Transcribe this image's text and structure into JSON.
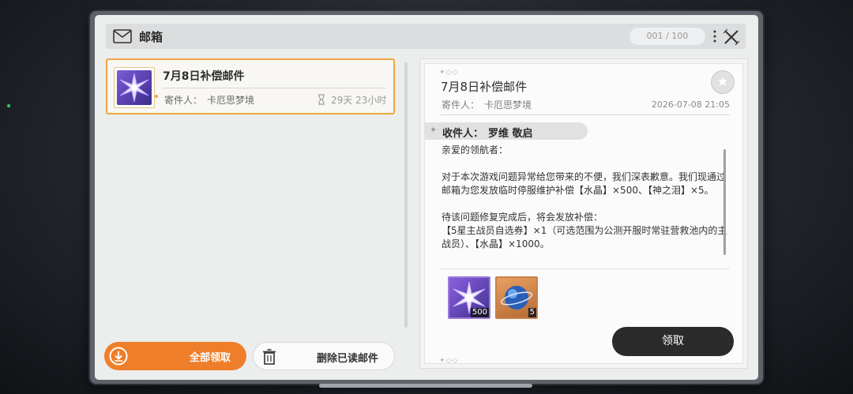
{
  "header": {
    "title": "邮箱",
    "counter": "001 / 100"
  },
  "mail_list": [
    {
      "title": "7月8日补偿邮件",
      "sender_label": "寄件人：",
      "sender": "卡厄思梦境",
      "expire": "29天 23小时"
    }
  ],
  "actions": {
    "claim_all": "全部领取",
    "delete_read": "删除已读邮件"
  },
  "detail": {
    "title": "7月8日补偿邮件",
    "sender_label": "寄件人：",
    "sender": "卡厄思梦境",
    "date": "2026-07-08 21:05",
    "recipient_label": "收件人：",
    "recipient": "罗维 敬启",
    "body": [
      "亲爱的领航者：",
      "对于本次游戏问题异常给您带来的不便，我们深表歉意。我们现通过邮箱为您发放临时停服维护补偿【水晶】×500、【神之泪】×5。",
      "待该问题修复完成后，将会发放补偿：",
      "【5星主战员自选券】×1（可选范围为公测开服时常驻营救池内的主战员）、【水晶】×1000。"
    ],
    "rewards": [
      {
        "icon": "crystal-icon",
        "qty": "500"
      },
      {
        "icon": "tear-orb-icon",
        "qty": "5"
      }
    ],
    "claim_label": "领取",
    "deco": "✦◇◇"
  },
  "colors": {
    "accent_orange": "#ef7e2a",
    "selected_border": "#f0a640",
    "dark_button": "#2b2b2b"
  }
}
